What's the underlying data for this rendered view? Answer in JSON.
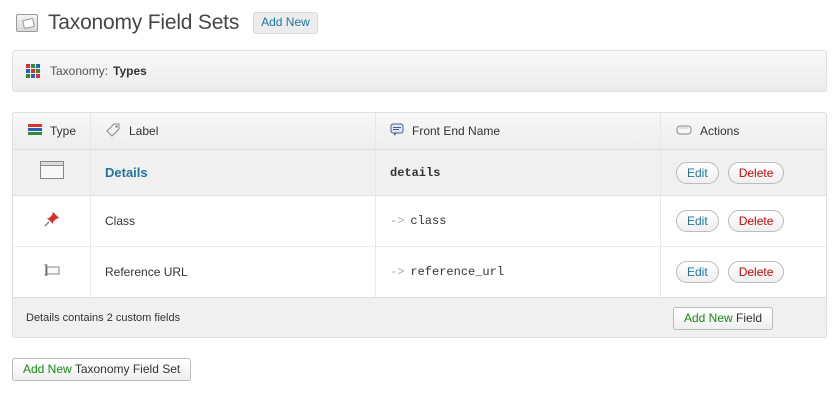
{
  "header": {
    "title": "Taxonomy Field Sets",
    "add_new_label": "Add New"
  },
  "taxonomy_bar": {
    "label": "Taxonomy:",
    "value": "Types"
  },
  "table": {
    "columns": {
      "type": "Type",
      "label": "Label",
      "front_end_name": "Front End Name",
      "actions": "Actions"
    },
    "rows": [
      {
        "type_icon": "window-icon",
        "label": "Details",
        "front_end_name": "details"
      },
      {
        "type_icon": "pushpin-icon",
        "label": "Class",
        "arrow": "->",
        "front_end_name": "class"
      },
      {
        "type_icon": "text-field-icon",
        "label": "Reference URL",
        "arrow": "->",
        "front_end_name": "reference_url"
      }
    ],
    "edit_label": "Edit",
    "delete_label": "Delete",
    "footer_text": "Details contains 2 custom fields",
    "add_field": {
      "prefix": "Add New",
      "suffix": "Field"
    }
  },
  "bottom": {
    "prefix": "Add New",
    "suffix": "Taxonomy Field Set"
  },
  "colors": {
    "link": "#21759b",
    "delete": "#bc0b0b",
    "add_green": "#1a8a1a"
  }
}
